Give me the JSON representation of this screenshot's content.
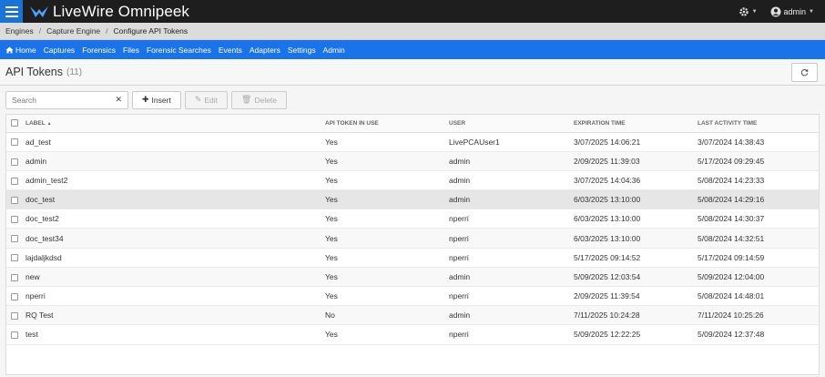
{
  "app": {
    "title": "LiveWire Omnipeek",
    "user": "admin"
  },
  "breadcrumb": {
    "items": [
      "Engines",
      "Capture Engine"
    ],
    "current": "Configure API Tokens"
  },
  "nav": {
    "items": [
      "Home",
      "Captures",
      "Forensics",
      "Files",
      "Forensic Searches",
      "Events",
      "Adapters",
      "Settings",
      "Admin"
    ]
  },
  "page": {
    "title": "API Tokens",
    "count": "(11)"
  },
  "toolbar": {
    "search_placeholder": "Search",
    "search_value": "",
    "insert_label": "Insert",
    "edit_label": "Edit",
    "delete_label": "Delete"
  },
  "table": {
    "columns": [
      "Label",
      "API Token in Use",
      "User",
      "Expiration Time",
      "Last Activity Time"
    ],
    "rows": [
      [
        "ad_test",
        "Yes",
        "LivePCAUser1",
        "3/07/2025 14:06:21",
        "3/07/2024 14:38:43"
      ],
      [
        "admin",
        "Yes",
        "admin",
        "2/09/2025 11:39:03",
        "5/17/2024 09:29:45"
      ],
      [
        "admin_test2",
        "Yes",
        "admin",
        "3/07/2025 14:04:36",
        "5/08/2024 14:23:33"
      ],
      [
        "doc_test",
        "Yes",
        "admin",
        "6/03/2025 13:10:00",
        "5/08/2024 14:29:16"
      ],
      [
        "doc_test2",
        "Yes",
        "nperri",
        "6/03/2025 13:10:00",
        "5/08/2024 14:30:37"
      ],
      [
        "doc_test34",
        "Yes",
        "nperri",
        "6/03/2025 13:10:00",
        "5/08/2024 14:32:51"
      ],
      [
        "lajdaljkdsd",
        "Yes",
        "nperri",
        "5/17/2025 09:14:52",
        "5/17/2024 09:14:59"
      ],
      [
        "new",
        "Yes",
        "admin",
        "5/09/2025 12:03:54",
        "5/09/2024 12:04:00"
      ],
      [
        "nperri",
        "Yes",
        "nperri",
        "2/09/2025 11:39:54",
        "5/08/2024 14:48:01"
      ],
      [
        "RQ Test",
        "No",
        "admin",
        "7/11/2025 10:24:28",
        "7/11/2024 10:25:26"
      ],
      [
        "test",
        "Yes",
        "nperri",
        "5/09/2025 12:22:25",
        "5/09/2024 12:37:48"
      ]
    ]
  },
  "colors": {
    "topbar": "#1e1e1e",
    "accent": "#1a73e8",
    "breadcrumb_bg": "#dcdcdc"
  }
}
